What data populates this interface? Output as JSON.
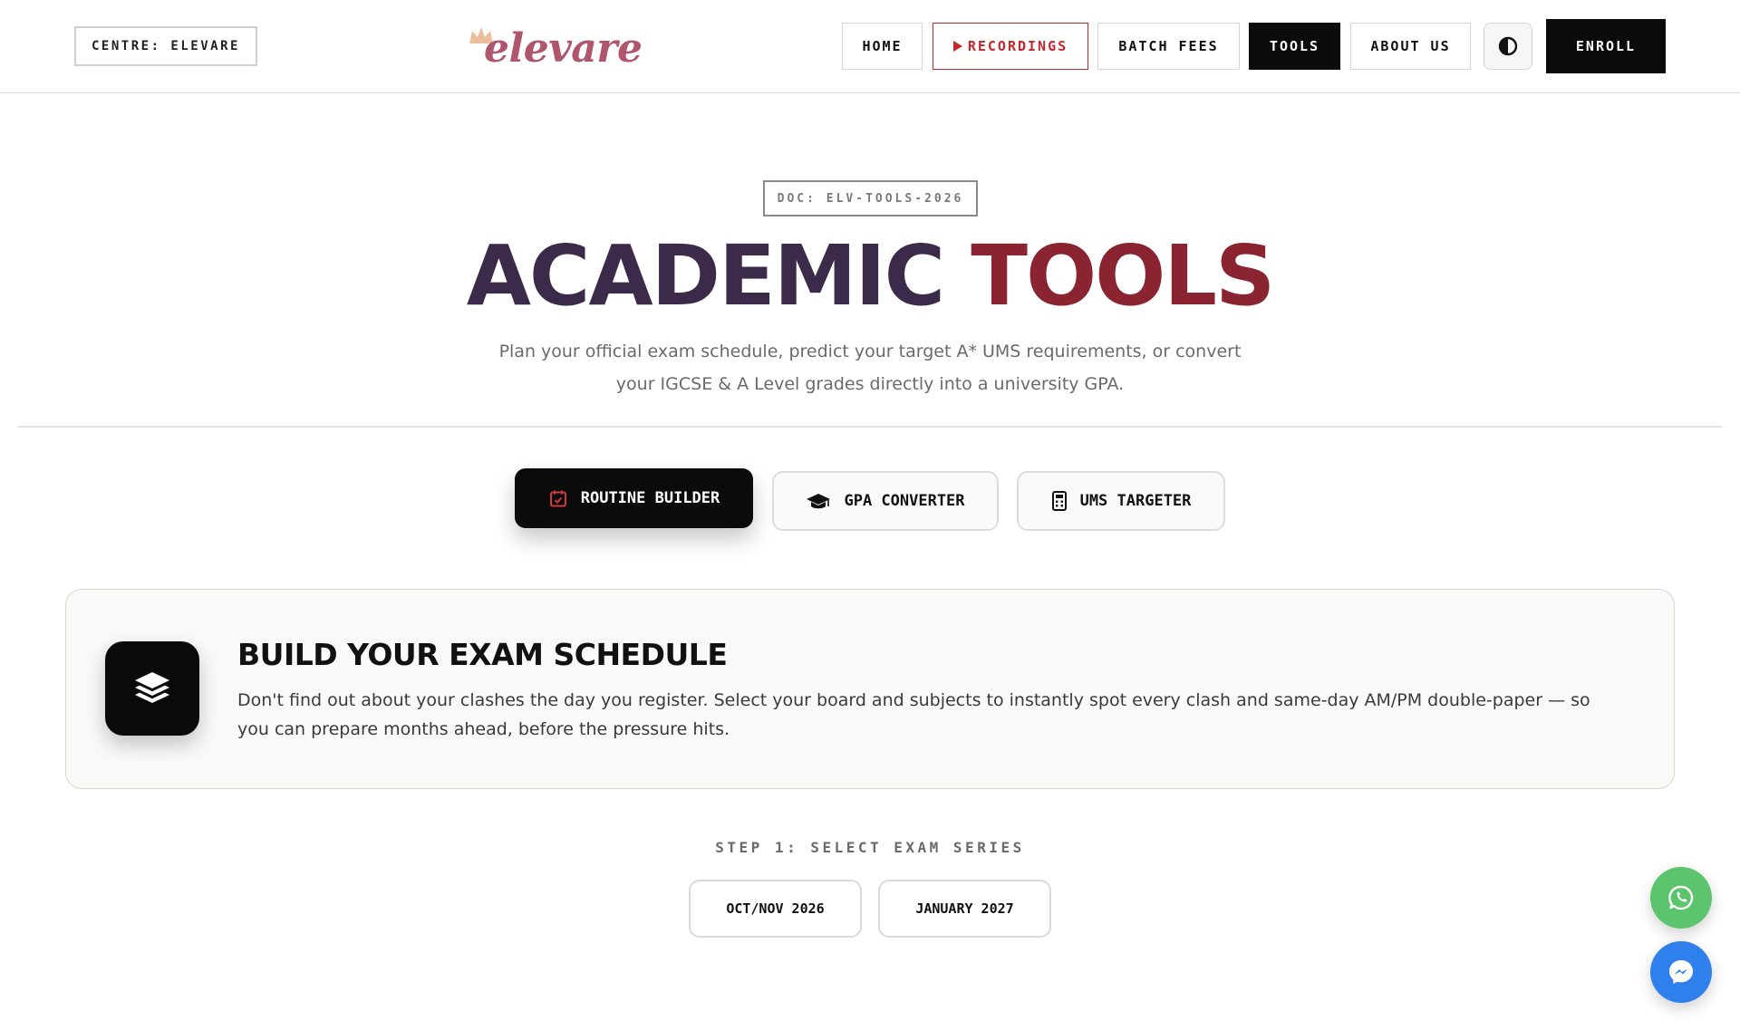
{
  "header": {
    "centre_badge": "CENTRE: ELEVARE",
    "logo_text": "elevare",
    "nav": [
      {
        "label": "HOME"
      },
      {
        "label": "RECORDINGS"
      },
      {
        "label": "BATCH FEES"
      },
      {
        "label": "TOOLS"
      },
      {
        "label": "ABOUT US"
      }
    ],
    "active_nav": "TOOLS",
    "theme_toggle_icon": "contrast-icon",
    "enroll_label": "ENROLL"
  },
  "hero": {
    "doc_badge": "DOC: ELV-TOOLS-2026",
    "title_word1": "ACADEMIC",
    "title_word2": "TOOLS",
    "subtitle_line1": "Plan your official exam schedule, predict your target A* UMS requirements, or convert",
    "subtitle_line2": "your IGCSE & A Level grades directly into a university GPA."
  },
  "tools_tabs": [
    {
      "label": "ROUTINE BUILDER",
      "icon": "calendar-check-icon",
      "active": true
    },
    {
      "label": "GPA CONVERTER",
      "icon": "graduation-cap-icon",
      "active": false
    },
    {
      "label": "UMS TARGETER",
      "icon": "calculator-icon",
      "active": false
    }
  ],
  "card": {
    "icon": "layers-icon",
    "title": "BUILD YOUR EXAM SCHEDULE",
    "description": "Don't find out about your clashes the day you register. Select your board and subjects to instantly spot every clash and same-day AM/PM double-paper — so you can prepare months ahead, before the pressure hits."
  },
  "step": {
    "label": "STEP 1: SELECT EXAM SERIES",
    "options": [
      "OCT/NOV 2026",
      "JANUARY 2027"
    ]
  },
  "floating": {
    "whatsapp_icon": "whatsapp-icon",
    "messenger_icon": "messenger-icon"
  },
  "colors": {
    "accent_red": "#c7262b",
    "title_purple": "#3b2a4a",
    "title_red": "#8a2430",
    "logo_pink": "#b0566c",
    "whatsapp_green": "#5cc46d",
    "messenger_blue": "#2f80ed"
  }
}
